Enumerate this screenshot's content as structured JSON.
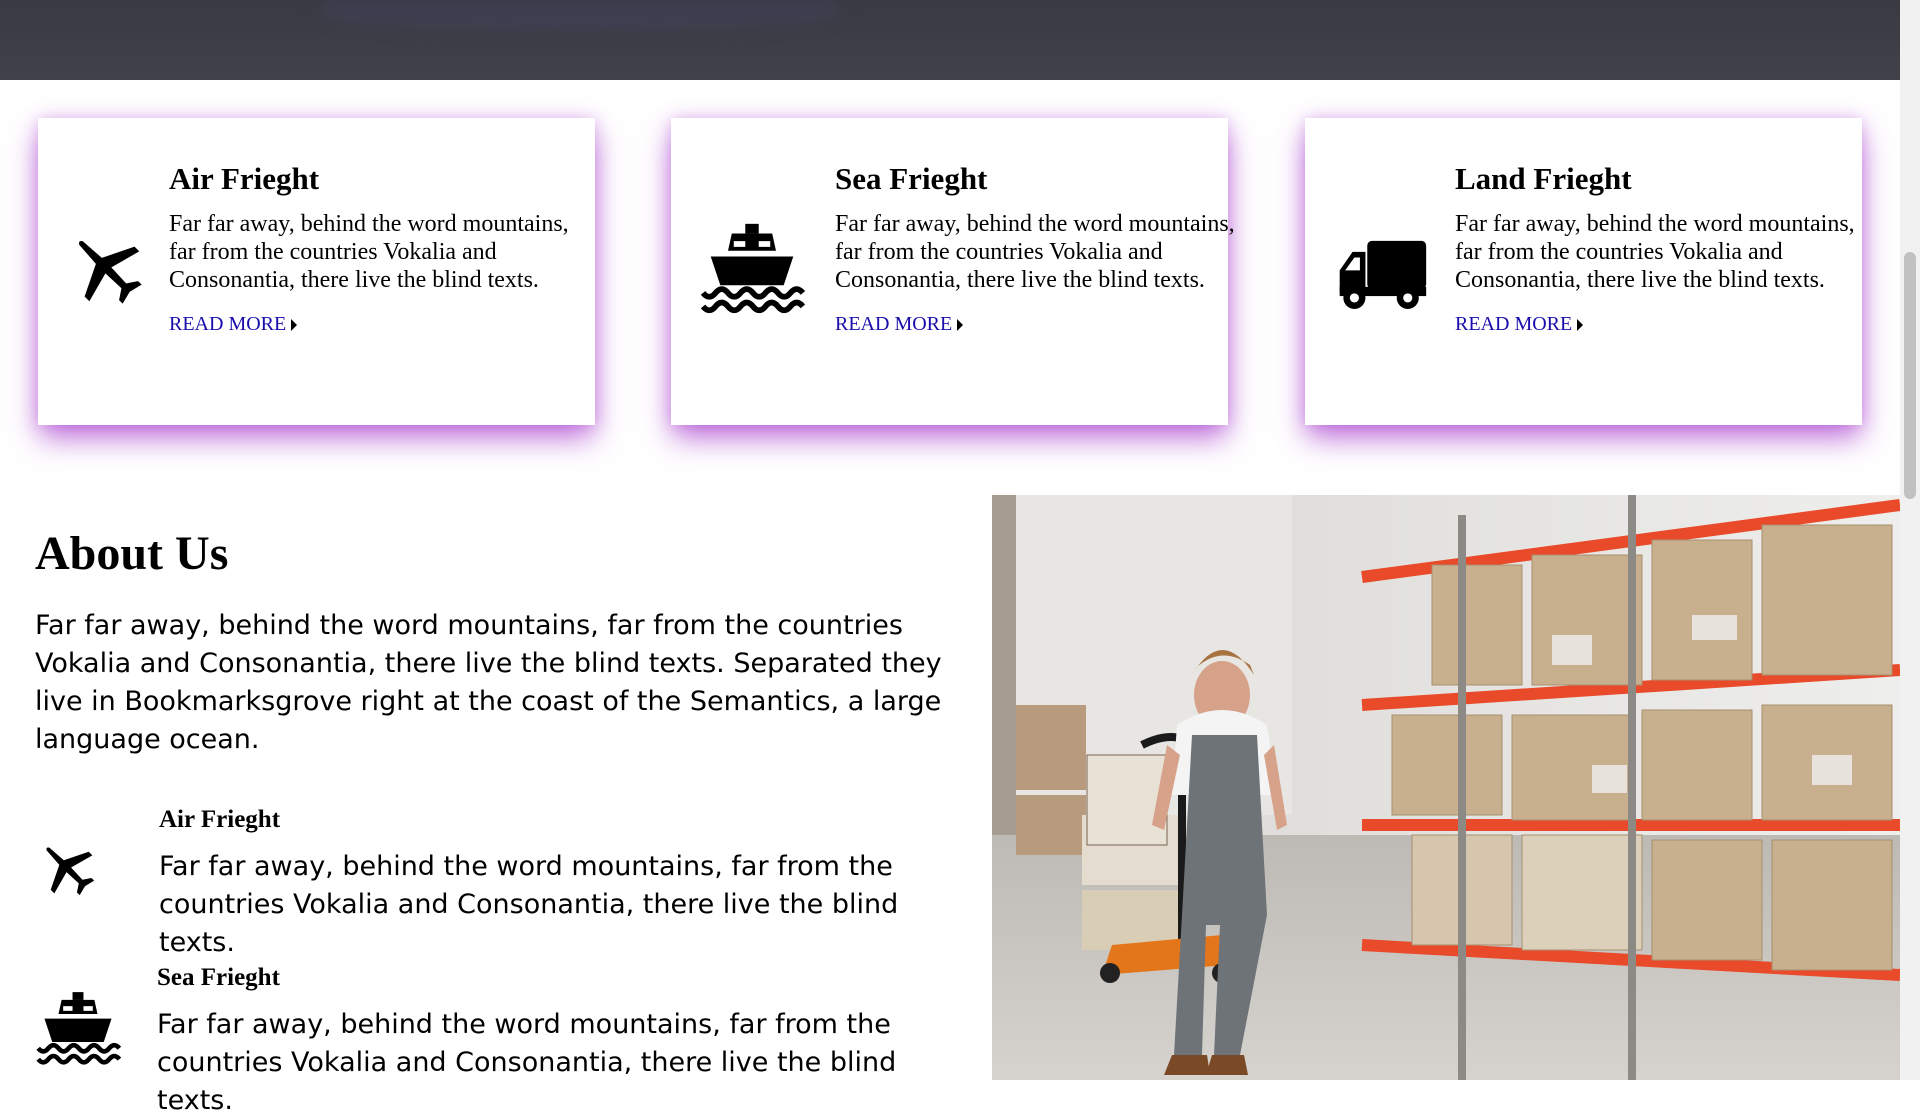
{
  "services": [
    {
      "title": "Air Frieght",
      "body": "Far far away, behind the word mountains, far from the countries Vokalia and Consonantia, there live the blind texts.",
      "link": "READ MORE",
      "icon": "plane-icon"
    },
    {
      "title": "Sea Frieght",
      "body": "Far far away, behind the word mountains, far from the countries Vokalia and Consonantia, there live the blind texts.",
      "link": "READ MORE",
      "icon": "ship-icon"
    },
    {
      "title": "Land Frieght",
      "body": "Far far away, behind the word mountains, far from the countries Vokalia and Consonantia, there live the blind texts.",
      "link": "READ MORE",
      "icon": "truck-icon"
    }
  ],
  "about": {
    "title": "About Us",
    "body": "Far far away, behind the word mountains, far from the countries Vokalia and Consonantia, there live the blind texts. Separated they live in Bookmarksgrove right at the coast of the Semantics, a large language ocean.",
    "features": [
      {
        "title": "Air Frieght",
        "body": "Far far away, behind the word mountains, far from the countries Vokalia and Consonantia, there live the blind texts.",
        "icon": "plane-icon"
      },
      {
        "title": "Sea Frieght",
        "body": "Far far away, behind the word mountains, far from the countries Vokalia and Consonantia, there live the blind texts.",
        "icon": "ship-icon"
      }
    ]
  },
  "colors": {
    "card_shadow": "#a638cc",
    "link": "#1a0dab",
    "hero": "#3a3a42"
  }
}
